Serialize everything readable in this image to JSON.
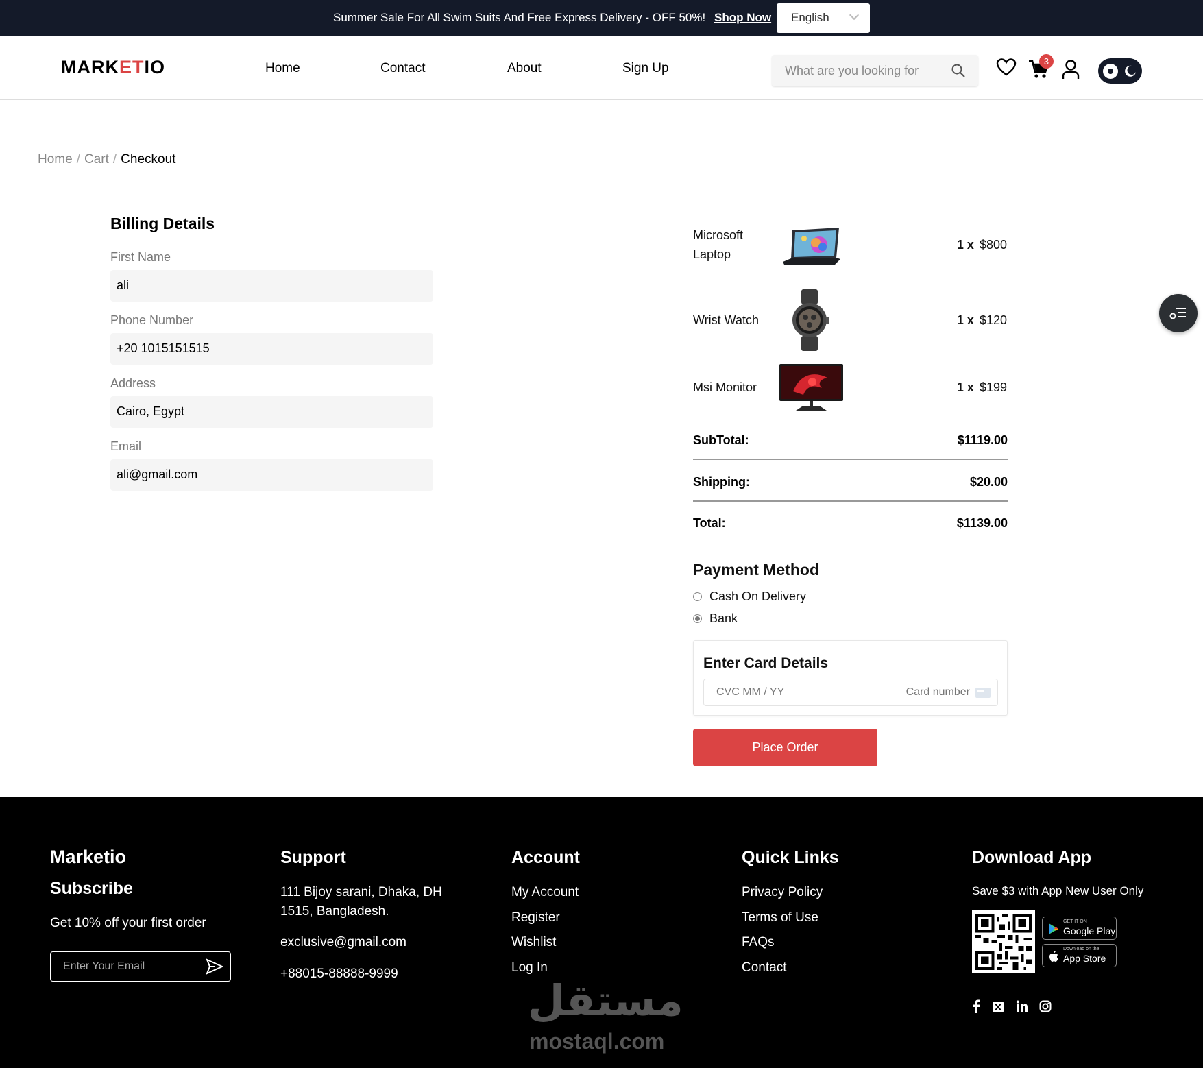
{
  "topbar": {
    "promo": "Summer Sale For All Swim Suits And Free Express Delivery - OFF 50%!",
    "shop_now": "Shop Now",
    "language": "English"
  },
  "header": {
    "logo_part1": "MARK",
    "logo_part2": "ET",
    "logo_part3": "IO",
    "nav": [
      "Home",
      "Contact",
      "About",
      "Sign Up"
    ],
    "search_placeholder": "What are you looking for",
    "cart_count": "3"
  },
  "breadcrumb": {
    "home": "Home",
    "cart": "Cart",
    "current": "Checkout",
    "sep": "/"
  },
  "billing": {
    "title": "Billing Details",
    "fields": [
      {
        "label": "First Name",
        "value": "ali"
      },
      {
        "label": "Phone Number",
        "value": "+20 1015151515"
      },
      {
        "label": "Address",
        "value": "Cairo, Egypt"
      },
      {
        "label": "Email",
        "value": "ali@gmail.com"
      }
    ]
  },
  "order": {
    "items": [
      {
        "name_line1": "Microsoft",
        "name_line2": "Laptop",
        "qty": "1 x",
        "price": "$800",
        "image": "laptop-image"
      },
      {
        "name_line1": "Wrist Watch",
        "name_line2": "",
        "qty": "1 x",
        "price": "$120",
        "image": "watch-image"
      },
      {
        "name_line1": "Msi Monitor",
        "name_line2": "",
        "qty": "1 x",
        "price": "$199",
        "image": "monitor-image"
      }
    ],
    "subtotal_label": "SubTotal:",
    "subtotal": "$1119.00",
    "shipping_label": "Shipping:",
    "shipping": "$20.00",
    "total_label": "Total:",
    "total": "$1139.00"
  },
  "payment": {
    "title": "Payment Method",
    "options": [
      {
        "label": "Cash On Delivery",
        "selected": false
      },
      {
        "label": "Bank",
        "selected": true
      }
    ],
    "card_title": "Enter Card Details",
    "card_left_placeholder": "CVC  MM / YY",
    "card_right_placeholder": "Card number",
    "place_order": "Place Order"
  },
  "footer": {
    "brand": "Marketio",
    "subscribe": "Subscribe",
    "offer": "Get 10% off your first order",
    "email_placeholder": "Enter Your Email",
    "support_title": "Support",
    "address_line1": "111 Bijoy sarani, Dhaka, DH",
    "address_line2": "1515, Bangladesh.",
    "email": "exclusive@gmail.com",
    "phone": "+88015-88888-9999",
    "account_title": "Account",
    "account_links": [
      "My Account",
      "Register",
      "Wishlist",
      "Log In"
    ],
    "quick_title": "Quick Links",
    "quick_links": [
      "Privacy Policy",
      "Terms of Use",
      "FAQs",
      "Contact"
    ],
    "app_title": "Download App",
    "app_note": "Save $3 with App New User Only",
    "google_small": "GET IT ON",
    "google_big": "Google Play",
    "apple_small": "Download on the",
    "apple_big": "App Store",
    "watermark_ar": "مستقل",
    "watermark_en": "mostaql.com"
  },
  "colors": {
    "accent": "#db4444",
    "dark": "#141a29",
    "footer_bg": "#000000"
  }
}
